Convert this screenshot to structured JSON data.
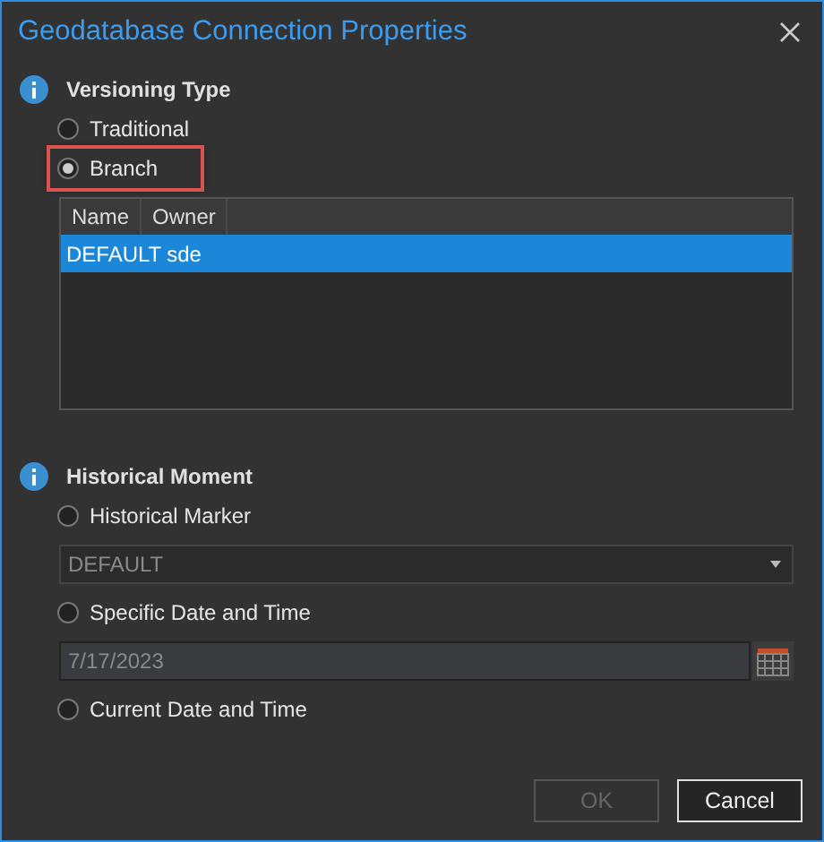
{
  "window": {
    "title": "Geodatabase Connection Properties"
  },
  "versioning": {
    "heading": "Versioning Type",
    "options": [
      {
        "label": "Traditional",
        "selected": false,
        "highlighted": false
      },
      {
        "label": "Branch",
        "selected": true,
        "highlighted": true
      }
    ],
    "table": {
      "columns": [
        "Name",
        "Owner"
      ],
      "rows": [
        {
          "cells": [
            "DEFAULT",
            "sde"
          ],
          "selected": true
        }
      ]
    }
  },
  "historical": {
    "heading": "Historical Moment",
    "items": [
      {
        "kind": "radio",
        "label": "Historical Marker",
        "selected": false
      },
      {
        "kind": "dropdown",
        "value": "DEFAULT"
      },
      {
        "kind": "radio",
        "label": "Specific Date and Time",
        "selected": false
      },
      {
        "kind": "date",
        "value": "7/17/2023"
      },
      {
        "kind": "radio",
        "label": "Current Date and Time",
        "selected": false
      }
    ]
  },
  "buttons": [
    {
      "label": "OK",
      "disabled": true
    },
    {
      "label": "Cancel",
      "disabled": false
    }
  ]
}
